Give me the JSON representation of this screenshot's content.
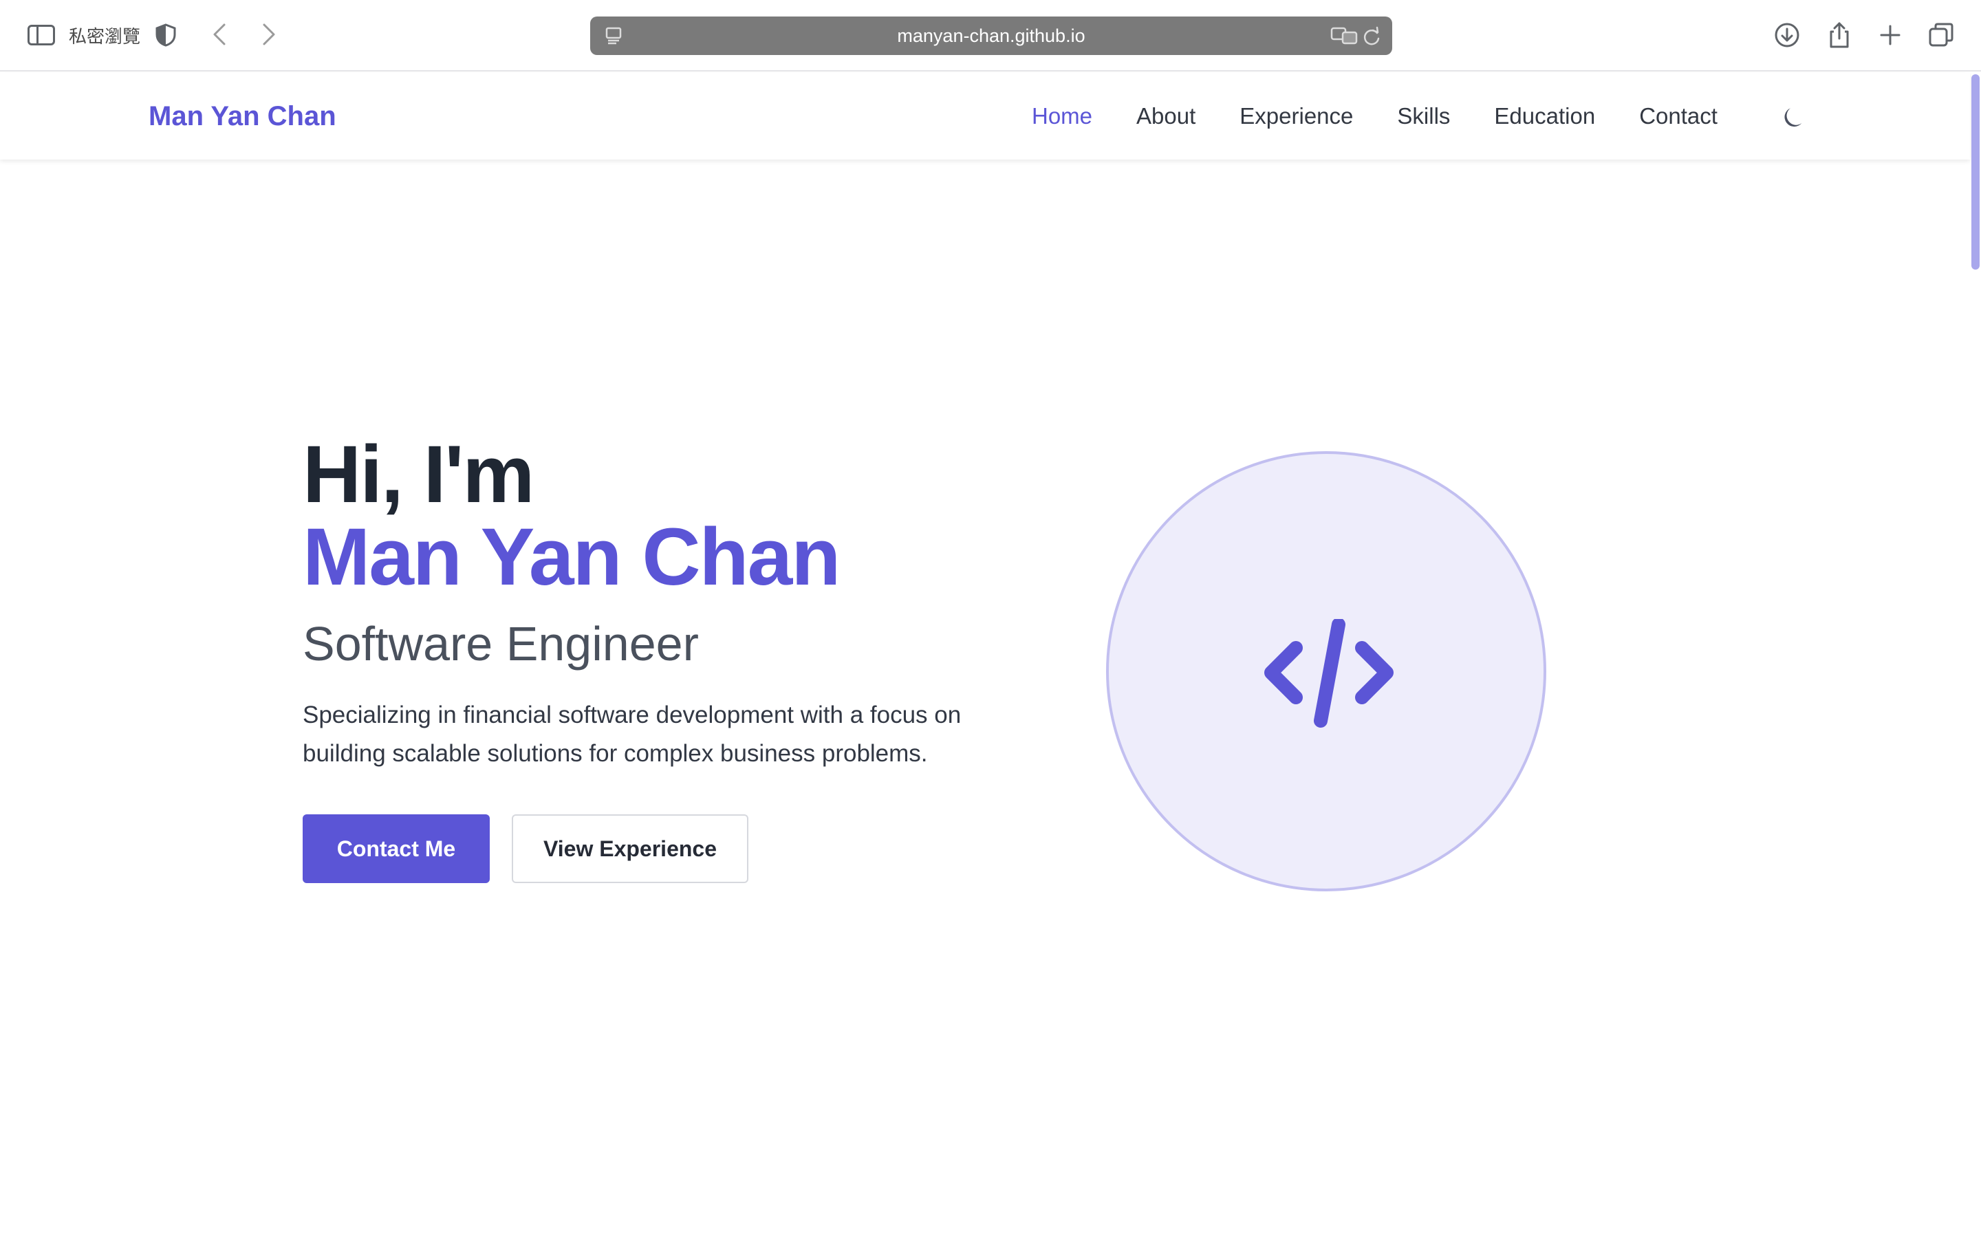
{
  "browser": {
    "private_label": "私密瀏覽",
    "url": "manyan-chan.github.io",
    "icons": [
      "sidebar-icon",
      "shield-icon",
      "back-icon",
      "forward-icon",
      "page-icon",
      "translate-icon",
      "reload-icon",
      "download-icon",
      "share-icon",
      "new-tab-icon",
      "tabs-icon"
    ]
  },
  "site": {
    "brand": "Man Yan Chan",
    "nav": [
      {
        "label": "Home",
        "active": true
      },
      {
        "label": "About",
        "active": false
      },
      {
        "label": "Experience",
        "active": false
      },
      {
        "label": "Skills",
        "active": false
      },
      {
        "label": "Education",
        "active": false
      },
      {
        "label": "Contact",
        "active": false
      }
    ],
    "theme_toggle_icon": "moon-icon"
  },
  "hero": {
    "greeting": "Hi, I'm",
    "name": "Man Yan Chan",
    "role": "Software Engineer",
    "tagline_line1": "Specializing in financial software development with a focus on",
    "tagline_line2": "building scalable solutions for complex business problems.",
    "primary_button": "Contact Me",
    "secondary_button": "View Experience",
    "illustration_icon": "code-icon"
  },
  "colors": {
    "accent": "#5b55d6",
    "heading": "#1f2733",
    "circle_fill": "#eeedfb",
    "circle_border": "#c2bff0"
  }
}
